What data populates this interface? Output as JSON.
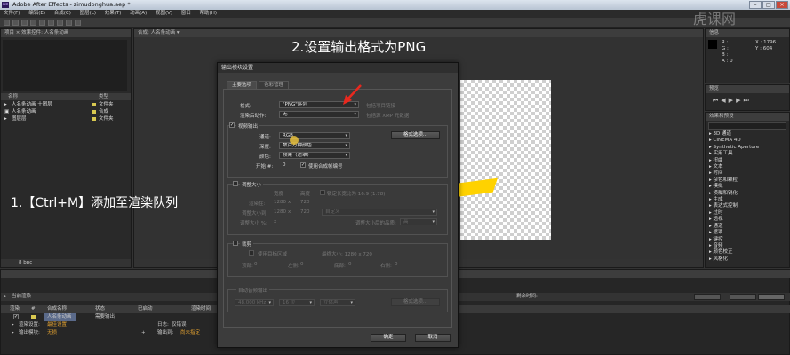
{
  "window": {
    "title": "Adobe After Effects - zimudonghua.aep *",
    "app_icon": "Ae"
  },
  "menubar": {
    "items": [
      "文件(F)",
      "编辑(E)",
      "合成(C)",
      "图层(L)",
      "效果(T)",
      "动画(A)",
      "视图(V)",
      "窗口",
      "帮助(H)"
    ]
  },
  "project": {
    "header": "项目 ×  效果控件: 人名条动画",
    "col_name": "名称",
    "col_type": "类型",
    "items": [
      {
        "name": "人名条动画 十图层",
        "type": "文件夹",
        "color": "#d8c850"
      },
      {
        "name": "人名条动画",
        "type": "合成",
        "color": "#d8c850"
      },
      {
        "name": "图层层",
        "type": "文件夹",
        "color": "#d8c850"
      }
    ],
    "bpc": "8 bpc"
  },
  "viewer": {
    "header": "合成: 人名条动画 ▾"
  },
  "info": {
    "header": "信息",
    "r": "R :",
    "g": "G :",
    "b": "B :",
    "a": "A : 0",
    "x": "X : 1796",
    "y": "Y : 604"
  },
  "preview": {
    "header": "预览"
  },
  "effects": {
    "header": "效果和预设",
    "items": [
      "3D 通道",
      "CINEMA 4D",
      "Synthetic Aperture",
      "实用工具",
      "扭曲",
      "文本",
      "时间",
      "杂色和颗粒",
      "模拟",
      "模糊和锐化",
      "生成",
      "表达式控制",
      "过时",
      "透视",
      "通道",
      "遮罩",
      "键控",
      "音频",
      "颜色校正",
      "风格化"
    ]
  },
  "render_queue": {
    "header": "当前渲染",
    "time_label": "剩余时间:",
    "cols": [
      "渲染",
      "#",
      "合成名称",
      "状态",
      "已启动",
      "渲染时间"
    ],
    "item_name": "人名条动画",
    "item_status": "需要输出",
    "render_settings_label": "渲染设置:",
    "render_settings_value": "最佳设置",
    "output_module_label": "输出模块:",
    "output_module_value": "无损",
    "log_label": "日志:",
    "log_value": "仅错误",
    "output_to_label": "输出到:",
    "output_to_value": "尚未指定"
  },
  "dialog": {
    "title": "输出模块设置",
    "tab_main": "主要选项",
    "tab_color": "色彩管理",
    "format_label": "格式:",
    "format_value": "\"PNG\"序列",
    "format_info": "包括项目链接",
    "post_render_label": "渲染后动作:",
    "post_render_value": "无",
    "include_xmp": "包括源 XMP 元数据",
    "video_output_label": "视频输出",
    "video_output_checked": true,
    "channels_label": "通道:",
    "channels_value": "RGB",
    "format_options_btn": "格式选项...",
    "depth_label": "深度:",
    "depth_value": "数百万种颜色",
    "color_label": "颜色:",
    "color_value": "预乘（遮罩）",
    "start_label": "开始 #:",
    "start_value": "0",
    "use_comp_frame": "使用合成帧编号",
    "resize_label": "调整大小",
    "resize_width": "宽度",
    "resize_height": "高度",
    "lock_ratio": "锁定长宽比为 16:9 (1.78)",
    "render_at": "渲染在:",
    "render_at_w": "1280",
    "render_at_h": "720",
    "resize_to": "调整大小到:",
    "resize_to_w": "1280",
    "resize_to_h": "720",
    "custom": "自定义",
    "resize_pct": "调整大小 %:",
    "resize_quality": "调整大小后的品质:",
    "quality_value": "高",
    "crop_label": "裁剪",
    "crop_roi": "使用目标区域",
    "final_size": "最终大小: 1280 x 720",
    "crop_top": "顶部:",
    "crop_left": "左侧:",
    "crop_bottom": "底部:",
    "crop_right": "右侧:",
    "zero": "0",
    "audio_output": "自动音频输出",
    "audio_rate": "48.000 kHz",
    "audio_bits": "16 位",
    "audio_channels": "立体声",
    "audio_format_btn": "格式选项...",
    "ok": "确定",
    "cancel": "取消"
  },
  "annotations": {
    "step1": "1.【Ctrl+M】添加至渲染队列",
    "step2": "2.设置输出格式为PNG"
  },
  "watermark": "虎课网"
}
